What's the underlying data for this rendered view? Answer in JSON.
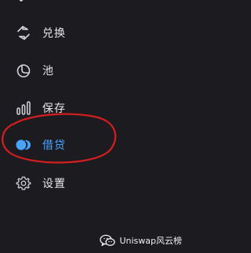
{
  "nav": {
    "items": [
      {
        "label": "兑换",
        "icon": "swap-icon"
      },
      {
        "label": "池",
        "icon": "pool-icon"
      },
      {
        "label": "保存",
        "icon": "bar-chart-icon"
      },
      {
        "label": "借贷",
        "icon": "toggle-icon",
        "active": true
      },
      {
        "label": "设置",
        "icon": "gear-icon"
      }
    ]
  },
  "watermark": {
    "text": "Uniswap风云榜"
  },
  "colors": {
    "background": "#1c1b20",
    "text": "#e7e6ea",
    "active": "#4aa4ff",
    "highlight_ring": "#d81e1e"
  }
}
